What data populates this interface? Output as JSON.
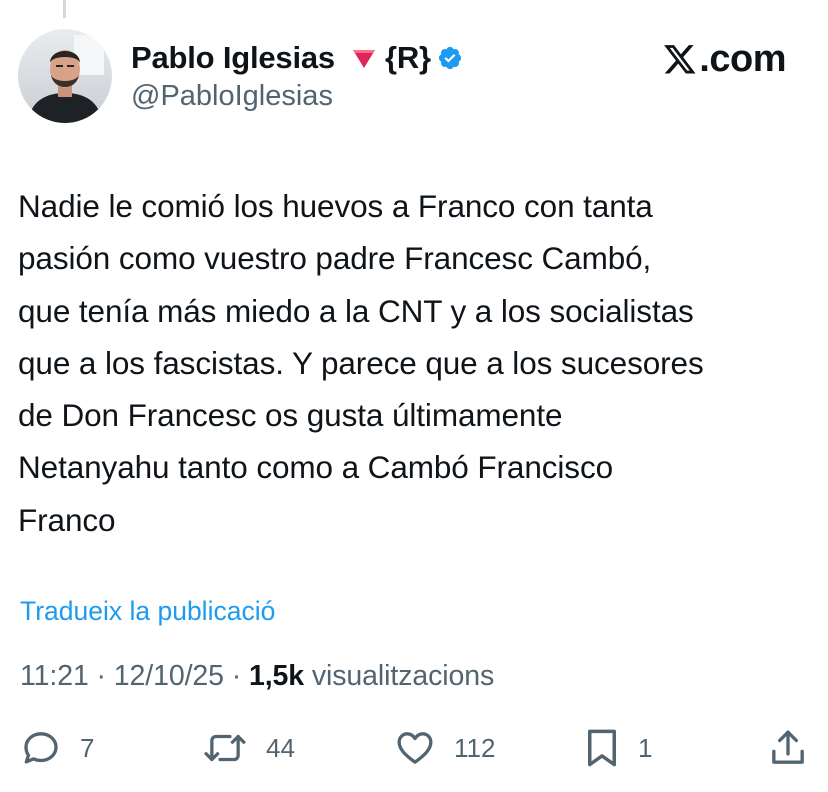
{
  "author": {
    "name": "Pablo Iglesias",
    "flag_icon": "red-down-triangle-icon",
    "badge_text": "{R}",
    "verified_icon": "verified-badge-icon",
    "handle": "@PabloIglesias"
  },
  "brand": {
    "text": ".com",
    "logo_icon": "x-logo-icon"
  },
  "tweet": {
    "text": "Nadie le comió los huevos a Franco con tanta\npasión como vuestro padre Francesc Cambó,\nque tenía más miedo a la CNT y a los socialistas\nque a los fascistas. Y parece que a los sucesores\nde Don Francesc os gusta últimamente\nNetanyahu tanto como a Cambó Francisco\nFranco",
    "translate_label": "Tradueix la publicació"
  },
  "meta": {
    "time": "11:21",
    "separator": "·",
    "date": "12/10/25",
    "views_count": "1,5k",
    "views_label": "visualitzacions"
  },
  "actions": {
    "reply": {
      "icon": "reply-icon",
      "count": "7"
    },
    "repost": {
      "icon": "repost-icon",
      "count": "44"
    },
    "like": {
      "icon": "heart-icon",
      "count": "112"
    },
    "bookmark": {
      "icon": "bookmark-icon",
      "count": "1"
    },
    "share": {
      "icon": "share-icon"
    }
  },
  "colors": {
    "text": "#0f1419",
    "secondary": "#536471",
    "accent": "#1d9bf0",
    "flag": "#e0245e"
  }
}
